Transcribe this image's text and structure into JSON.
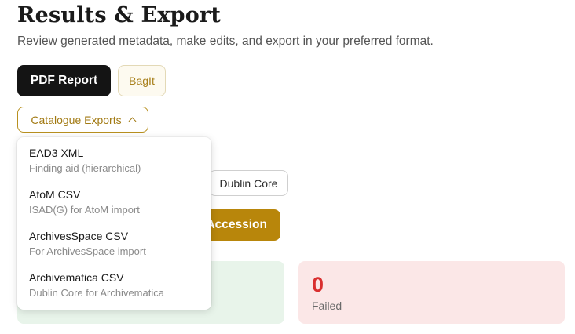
{
  "header": {
    "title": "Results & Export",
    "subtitle": "Review generated metadata, make edits, and export in your preferred format."
  },
  "toolbar": {
    "pdf_label": "PDF Report",
    "bagit_label": "BagIt",
    "catalogue_label": "Catalogue Exports",
    "dublin_core_label": "Dublin Core",
    "accession_label": "Accession"
  },
  "catalogue_menu": {
    "items": [
      {
        "label": "EAD3 XML",
        "description": "Finding aid (hierarchical)"
      },
      {
        "label": "AtoM CSV",
        "description": "ISAD(G) for AtoM import"
      },
      {
        "label": "ArchivesSpace CSV",
        "description": "For ArchivesSpace import"
      },
      {
        "label": "Archivematica CSV",
        "description": "Dublin Core for Archivematica"
      }
    ]
  },
  "stats": {
    "failed": {
      "count": "0",
      "label": "Failed"
    }
  },
  "colors": {
    "accent": "#b8860b",
    "primary_button": "#141414",
    "success_bg": "#e8f4ea",
    "failed_bg": "#fbe7e7",
    "failed_text": "#d92f2f"
  }
}
